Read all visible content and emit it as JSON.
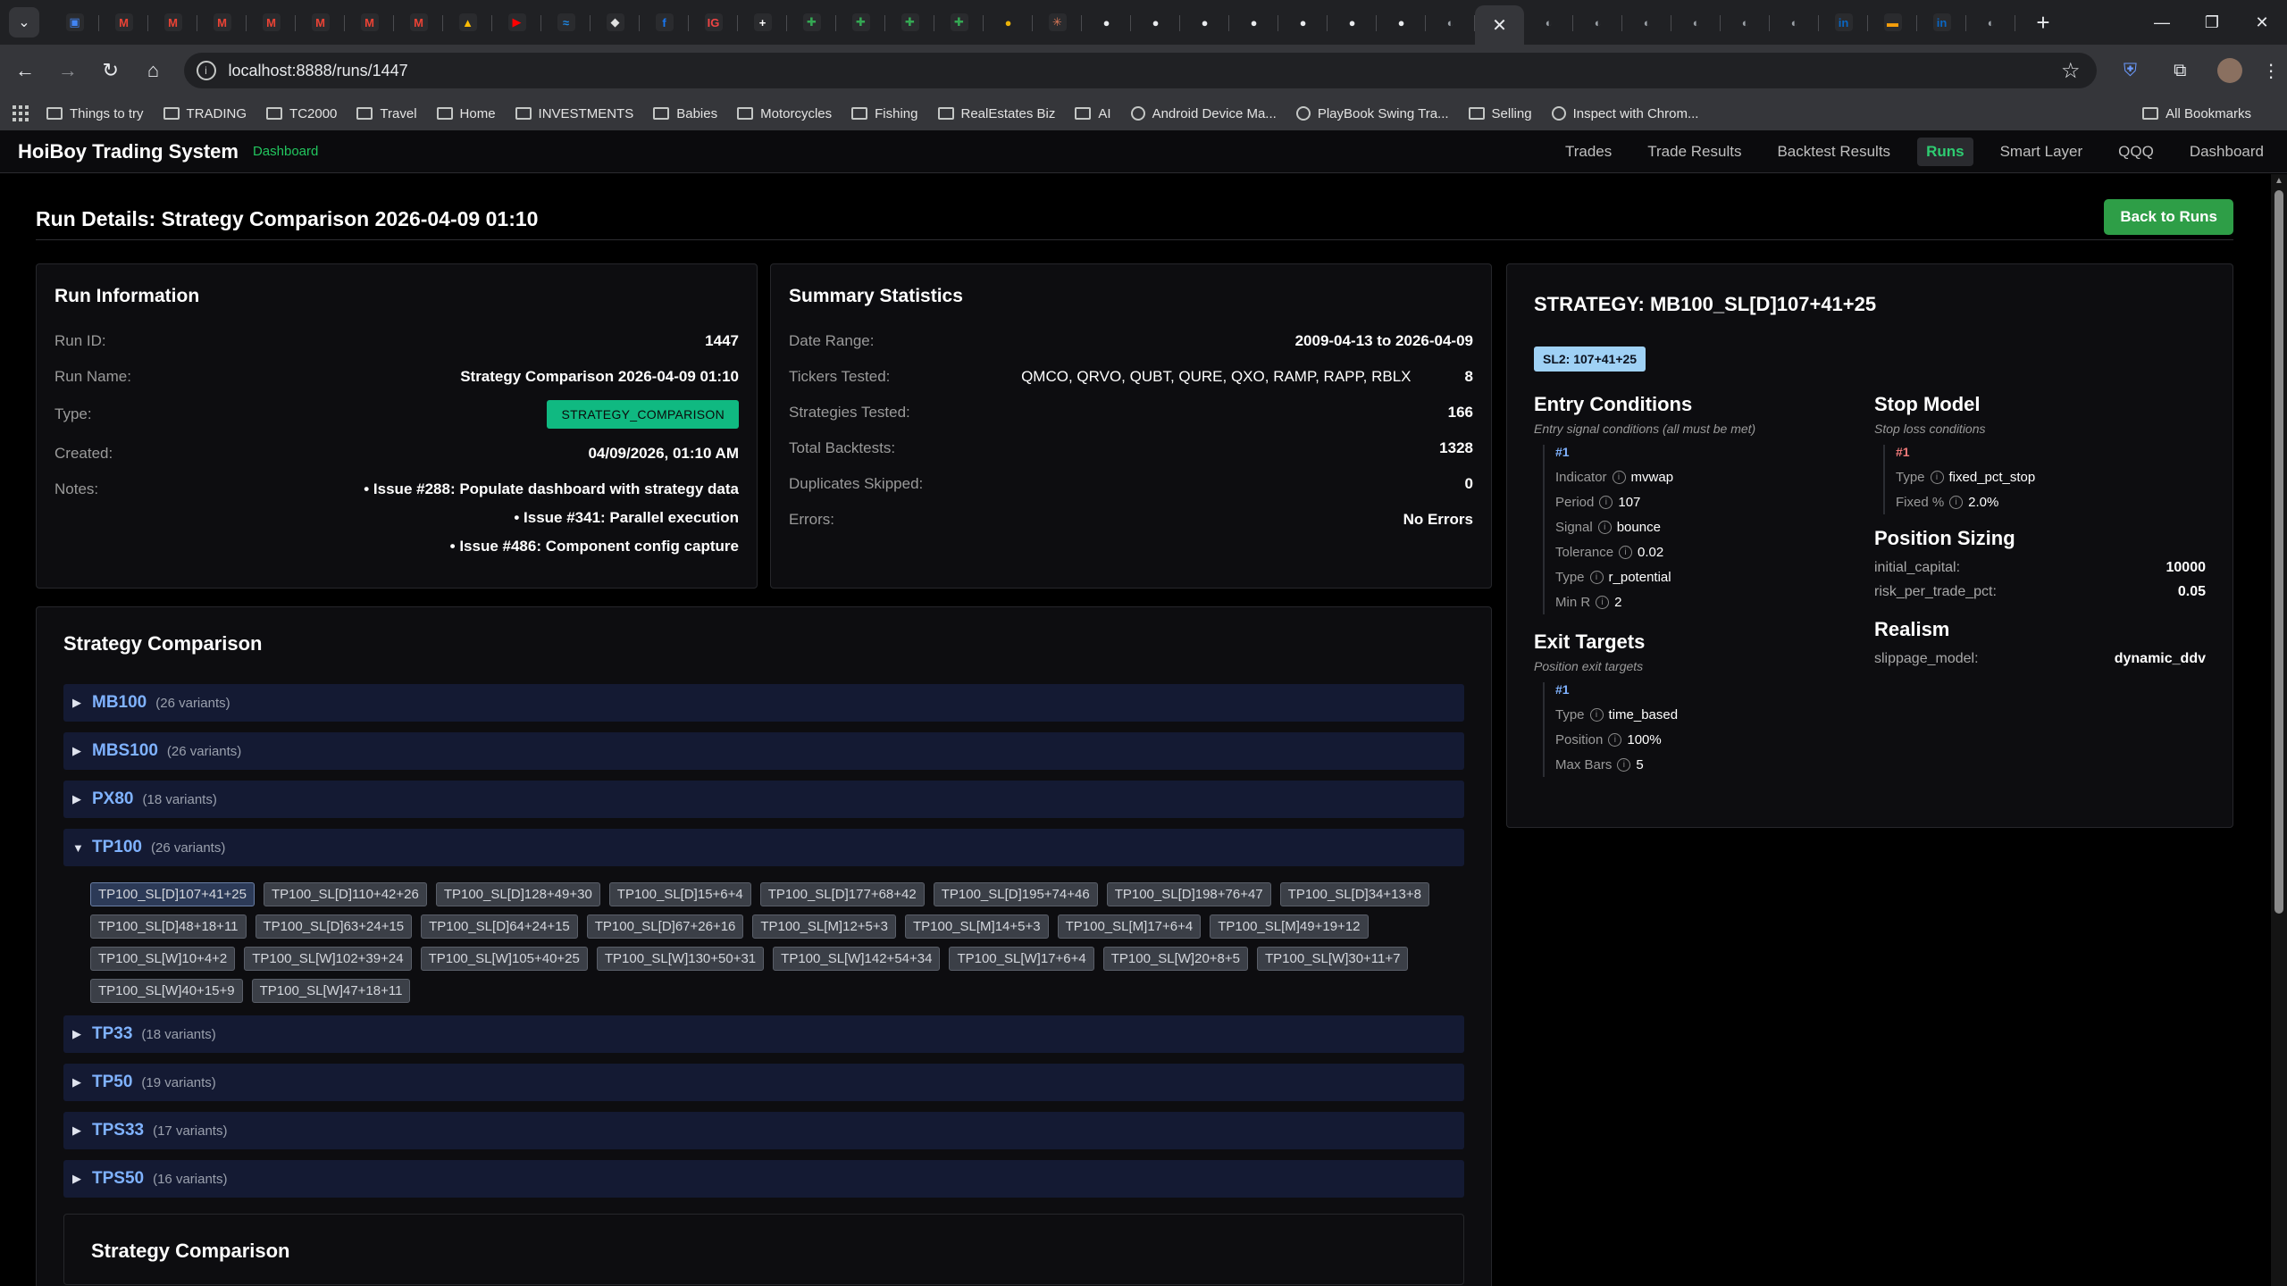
{
  "browser": {
    "url": "localhost:8888/runs/1447",
    "tabs": [
      {
        "icon": "calendar-icon",
        "color": "#4285f4",
        "glyph": "▣"
      },
      {
        "icon": "gmail-icon",
        "color": "#ea4335",
        "glyph": "M"
      },
      {
        "icon": "gmail-icon",
        "color": "#ea4335",
        "glyph": "M"
      },
      {
        "icon": "gmail-icon",
        "color": "#ea4335",
        "glyph": "M"
      },
      {
        "icon": "gmail-icon",
        "color": "#ea4335",
        "glyph": "M"
      },
      {
        "icon": "gmail-icon",
        "color": "#ea4335",
        "glyph": "M"
      },
      {
        "icon": "gmail-icon",
        "color": "#ea4335",
        "glyph": "M"
      },
      {
        "icon": "gmail-icon",
        "color": "#ea4335",
        "glyph": "M"
      },
      {
        "icon": "drive-icon",
        "color": "#fbbc04",
        "glyph": "▲"
      },
      {
        "icon": "youtube-icon",
        "color": "#ff0000",
        "glyph": "▶"
      },
      {
        "icon": "chart-app-icon",
        "color": "#1e88e5",
        "glyph": "≈"
      },
      {
        "icon": "shield-app-icon",
        "color": "#e0e0e0",
        "glyph": "◆"
      },
      {
        "icon": "facebook-icon",
        "color": "#1877f2",
        "glyph": "f"
      },
      {
        "icon": "ig-icon",
        "color": "#ef4444",
        "glyph": "IG"
      },
      {
        "icon": "plus-app-icon",
        "color": "#ffffff",
        "glyph": "+"
      },
      {
        "icon": "sheets-icon",
        "color": "#34a853",
        "glyph": "✚"
      },
      {
        "icon": "sheets-icon",
        "color": "#34a853",
        "glyph": "✚"
      },
      {
        "icon": "sheets-icon",
        "color": "#34a853",
        "glyph": "✚"
      },
      {
        "icon": "sheets-icon",
        "color": "#34a853",
        "glyph": "✚"
      },
      {
        "icon": "coin-icon",
        "color": "#eab308",
        "glyph": "●"
      },
      {
        "icon": "claude-icon",
        "color": "#d97757",
        "glyph": "✳"
      },
      {
        "icon": "github-icon",
        "color": "#e8eaed",
        "glyph": "●"
      },
      {
        "icon": "github-icon",
        "color": "#e8eaed",
        "glyph": "●"
      },
      {
        "icon": "github-icon",
        "color": "#e8eaed",
        "glyph": "●"
      },
      {
        "icon": "github-icon",
        "color": "#e8eaed",
        "glyph": "●"
      },
      {
        "icon": "github-icon",
        "color": "#e8eaed",
        "glyph": "●"
      },
      {
        "icon": "github-icon",
        "color": "#e8eaed",
        "glyph": "●"
      },
      {
        "icon": "github-icon",
        "color": "#e8eaed",
        "glyph": "●"
      },
      {
        "icon": "globe-icon",
        "color": "#9aa0a6",
        "glyph": "◐"
      },
      {
        "icon": "close-tab-icon",
        "color": "#e8eaed",
        "glyph": "✕",
        "active": true
      },
      {
        "icon": "globe-icon",
        "color": "#9aa0a6",
        "glyph": "◐"
      },
      {
        "icon": "globe-icon",
        "color": "#9aa0a6",
        "glyph": "◐"
      },
      {
        "icon": "globe-icon",
        "color": "#9aa0a6",
        "glyph": "◐"
      },
      {
        "icon": "globe-icon",
        "color": "#9aa0a6",
        "glyph": "◐"
      },
      {
        "icon": "globe-icon",
        "color": "#9aa0a6",
        "glyph": "◐"
      },
      {
        "icon": "globe-icon",
        "color": "#9aa0a6",
        "glyph": "◐"
      },
      {
        "icon": "linkedin-icon",
        "color": "#0a66c2",
        "glyph": "in"
      },
      {
        "icon": "flag-icon",
        "color": "#f59e0b",
        "glyph": "▬"
      },
      {
        "icon": "linkedin-icon",
        "color": "#0a66c2",
        "glyph": "in"
      },
      {
        "icon": "globe-icon",
        "color": "#9aa0a6",
        "glyph": "◐"
      }
    ],
    "bookmarks": [
      {
        "label": "Things to try",
        "type": "folder"
      },
      {
        "label": "TRADING",
        "type": "folder"
      },
      {
        "label": "TC2000",
        "type": "folder"
      },
      {
        "label": "Travel",
        "type": "folder"
      },
      {
        "label": "Home",
        "type": "folder"
      },
      {
        "label": "INVESTMENTS",
        "type": "folder"
      },
      {
        "label": "Babies",
        "type": "folder"
      },
      {
        "label": "Motorcycles",
        "type": "folder"
      },
      {
        "label": "Fishing",
        "type": "folder"
      },
      {
        "label": "RealEstates Biz",
        "type": "folder"
      },
      {
        "label": "AI",
        "type": "folder"
      },
      {
        "label": "Android Device Ma...",
        "type": "link"
      },
      {
        "label": "PlayBook Swing Tra...",
        "type": "link"
      },
      {
        "label": "Selling",
        "type": "folder"
      },
      {
        "label": "Inspect with Chrom...",
        "type": "link"
      }
    ],
    "all_bookmarks": "All Bookmarks"
  },
  "app": {
    "brand": "HoiBoy Trading System",
    "brand_sub": "Dashboard",
    "nav": [
      {
        "label": "Trades",
        "active": false
      },
      {
        "label": "Trade Results",
        "active": false
      },
      {
        "label": "Backtest Results",
        "active": false
      },
      {
        "label": "Runs",
        "active": true
      },
      {
        "label": "Smart Layer",
        "active": false
      },
      {
        "label": "QQQ",
        "active": false
      },
      {
        "label": "Dashboard",
        "active": false
      }
    ]
  },
  "page": {
    "title": "Run Details: Strategy Comparison 2026-04-09 01:10",
    "back_label": "Back to Runs"
  },
  "run_info": {
    "title": "Run Information",
    "run_id_label": "Run ID:",
    "run_id": "1447",
    "run_name_label": "Run Name:",
    "run_name": "Strategy Comparison 2026-04-09 01:10",
    "type_label": "Type:",
    "type": "STRATEGY_COMPARISON",
    "created_label": "Created:",
    "created": "04/09/2026, 01:10 AM",
    "notes_label": "Notes:",
    "notes": [
      "• Issue #288: Populate dashboard with strategy data",
      "• Issue #341: Parallel execution",
      "• Issue #486: Component config capture"
    ]
  },
  "summary": {
    "title": "Summary Statistics",
    "date_range_label": "Date Range:",
    "date_range": "2009-04-13 to 2026-04-09",
    "tickers_label": "Tickers Tested:",
    "tickers": "QMCO, QRVO, QUBT, QURE, QXO, RAMP, RAPP, RBLX",
    "tickers_count": "8",
    "strategies_label": "Strategies Tested:",
    "strategies": "166",
    "backtests_label": "Total Backtests:",
    "backtests": "1328",
    "duplicates_label": "Duplicates Skipped:",
    "duplicates": "0",
    "errors_label": "Errors:",
    "errors": "No Errors"
  },
  "comparison": {
    "title": "Strategy Comparison",
    "second_title": "Strategy Comparison",
    "groups_top": [
      {
        "name": "MB100",
        "count": "(26 variants)"
      },
      {
        "name": "MBS100",
        "count": "(26 variants)"
      },
      {
        "name": "PX80",
        "count": "(18 variants)"
      }
    ],
    "expanded": {
      "name": "TP100",
      "count": "(26 variants)",
      "chips": [
        "TP100_SL[D]107+41+25",
        "TP100_SL[D]110+42+26",
        "TP100_SL[D]128+49+30",
        "TP100_SL[D]15+6+4",
        "TP100_SL[D]177+68+42",
        "TP100_SL[D]195+74+46",
        "TP100_SL[D]198+76+47",
        "TP100_SL[D]34+13+8",
        "TP100_SL[D]48+18+11",
        "TP100_SL[D]63+24+15",
        "TP100_SL[D]64+24+15",
        "TP100_SL[D]67+26+16",
        "TP100_SL[M]12+5+3",
        "TP100_SL[M]14+5+3",
        "TP100_SL[M]17+6+4",
        "TP100_SL[M]49+19+12",
        "TP100_SL[W]10+4+2",
        "TP100_SL[W]102+39+24",
        "TP100_SL[W]105+40+25",
        "TP100_SL[W]130+50+31",
        "TP100_SL[W]142+54+34",
        "TP100_SL[W]17+6+4",
        "TP100_SL[W]20+8+5",
        "TP100_SL[W]30+11+7",
        "TP100_SL[W]40+15+9",
        "TP100_SL[W]47+18+11"
      ]
    },
    "groups_bottom": [
      {
        "name": "TP33",
        "count": "(18 variants)"
      },
      {
        "name": "TP50",
        "count": "(19 variants)"
      },
      {
        "name": "TPS33",
        "count": "(17 variants)"
      },
      {
        "name": "TPS50",
        "count": "(16 variants)"
      }
    ]
  },
  "strategy": {
    "title": "STRATEGY: MB100_SL[D]107+41+25",
    "badge": "SL2: 107+41+25",
    "entry": {
      "title": "Entry Conditions",
      "subtitle": "Entry signal conditions (all must be met)",
      "num": "#1",
      "rows": [
        {
          "k": "Indicator",
          "v": "mvwap"
        },
        {
          "k": "Period",
          "v": "107"
        },
        {
          "k": "Signal",
          "v": "bounce"
        },
        {
          "k": "Tolerance",
          "v": "0.02"
        },
        {
          "k": "Type",
          "v": "r_potential"
        },
        {
          "k": "Min R",
          "v": "2"
        }
      ]
    },
    "exit": {
      "title": "Exit Targets",
      "subtitle": "Position exit targets",
      "num": "#1",
      "rows": [
        {
          "k": "Type",
          "v": "time_based"
        },
        {
          "k": "Position",
          "v": "100%"
        },
        {
          "k": "Max Bars",
          "v": "5"
        }
      ]
    },
    "stop": {
      "title": "Stop Model",
      "subtitle": "Stop loss conditions",
      "num": "#1",
      "rows": [
        {
          "k": "Type",
          "v": "fixed_pct_stop"
        },
        {
          "k": "Fixed %",
          "v": "2.0%"
        }
      ]
    },
    "sizing": {
      "title": "Position Sizing",
      "rows": [
        {
          "k": "initial_capital:",
          "v": "10000"
        },
        {
          "k": "risk_per_trade_pct:",
          "v": "0.05"
        }
      ]
    },
    "realism": {
      "title": "Realism",
      "rows": [
        {
          "k": "slippage_model:",
          "v": "dynamic_ddv"
        }
      ]
    }
  }
}
